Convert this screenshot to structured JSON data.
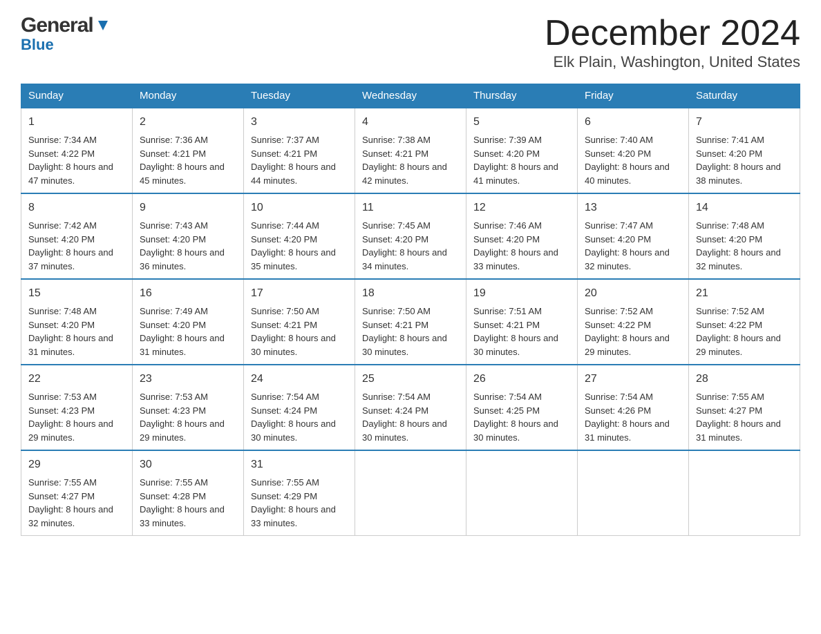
{
  "header": {
    "logo": {
      "general": "General",
      "blue": "Blue"
    },
    "month": "December 2024",
    "location": "Elk Plain, Washington, United States"
  },
  "days_of_week": [
    "Sunday",
    "Monday",
    "Tuesday",
    "Wednesday",
    "Thursday",
    "Friday",
    "Saturday"
  ],
  "weeks": [
    [
      {
        "day": "1",
        "sunrise": "7:34 AM",
        "sunset": "4:22 PM",
        "daylight": "8 hours and 47 minutes."
      },
      {
        "day": "2",
        "sunrise": "7:36 AM",
        "sunset": "4:21 PM",
        "daylight": "8 hours and 45 minutes."
      },
      {
        "day": "3",
        "sunrise": "7:37 AM",
        "sunset": "4:21 PM",
        "daylight": "8 hours and 44 minutes."
      },
      {
        "day": "4",
        "sunrise": "7:38 AM",
        "sunset": "4:21 PM",
        "daylight": "8 hours and 42 minutes."
      },
      {
        "day": "5",
        "sunrise": "7:39 AM",
        "sunset": "4:20 PM",
        "daylight": "8 hours and 41 minutes."
      },
      {
        "day": "6",
        "sunrise": "7:40 AM",
        "sunset": "4:20 PM",
        "daylight": "8 hours and 40 minutes."
      },
      {
        "day": "7",
        "sunrise": "7:41 AM",
        "sunset": "4:20 PM",
        "daylight": "8 hours and 38 minutes."
      }
    ],
    [
      {
        "day": "8",
        "sunrise": "7:42 AM",
        "sunset": "4:20 PM",
        "daylight": "8 hours and 37 minutes."
      },
      {
        "day": "9",
        "sunrise": "7:43 AM",
        "sunset": "4:20 PM",
        "daylight": "8 hours and 36 minutes."
      },
      {
        "day": "10",
        "sunrise": "7:44 AM",
        "sunset": "4:20 PM",
        "daylight": "8 hours and 35 minutes."
      },
      {
        "day": "11",
        "sunrise": "7:45 AM",
        "sunset": "4:20 PM",
        "daylight": "8 hours and 34 minutes."
      },
      {
        "day": "12",
        "sunrise": "7:46 AM",
        "sunset": "4:20 PM",
        "daylight": "8 hours and 33 minutes."
      },
      {
        "day": "13",
        "sunrise": "7:47 AM",
        "sunset": "4:20 PM",
        "daylight": "8 hours and 32 minutes."
      },
      {
        "day": "14",
        "sunrise": "7:48 AM",
        "sunset": "4:20 PM",
        "daylight": "8 hours and 32 minutes."
      }
    ],
    [
      {
        "day": "15",
        "sunrise": "7:48 AM",
        "sunset": "4:20 PM",
        "daylight": "8 hours and 31 minutes."
      },
      {
        "day": "16",
        "sunrise": "7:49 AM",
        "sunset": "4:20 PM",
        "daylight": "8 hours and 31 minutes."
      },
      {
        "day": "17",
        "sunrise": "7:50 AM",
        "sunset": "4:21 PM",
        "daylight": "8 hours and 30 minutes."
      },
      {
        "day": "18",
        "sunrise": "7:50 AM",
        "sunset": "4:21 PM",
        "daylight": "8 hours and 30 minutes."
      },
      {
        "day": "19",
        "sunrise": "7:51 AM",
        "sunset": "4:21 PM",
        "daylight": "8 hours and 30 minutes."
      },
      {
        "day": "20",
        "sunrise": "7:52 AM",
        "sunset": "4:22 PM",
        "daylight": "8 hours and 29 minutes."
      },
      {
        "day": "21",
        "sunrise": "7:52 AM",
        "sunset": "4:22 PM",
        "daylight": "8 hours and 29 minutes."
      }
    ],
    [
      {
        "day": "22",
        "sunrise": "7:53 AM",
        "sunset": "4:23 PM",
        "daylight": "8 hours and 29 minutes."
      },
      {
        "day": "23",
        "sunrise": "7:53 AM",
        "sunset": "4:23 PM",
        "daylight": "8 hours and 29 minutes."
      },
      {
        "day": "24",
        "sunrise": "7:54 AM",
        "sunset": "4:24 PM",
        "daylight": "8 hours and 30 minutes."
      },
      {
        "day": "25",
        "sunrise": "7:54 AM",
        "sunset": "4:24 PM",
        "daylight": "8 hours and 30 minutes."
      },
      {
        "day": "26",
        "sunrise": "7:54 AM",
        "sunset": "4:25 PM",
        "daylight": "8 hours and 30 minutes."
      },
      {
        "day": "27",
        "sunrise": "7:54 AM",
        "sunset": "4:26 PM",
        "daylight": "8 hours and 31 minutes."
      },
      {
        "day": "28",
        "sunrise": "7:55 AM",
        "sunset": "4:27 PM",
        "daylight": "8 hours and 31 minutes."
      }
    ],
    [
      {
        "day": "29",
        "sunrise": "7:55 AM",
        "sunset": "4:27 PM",
        "daylight": "8 hours and 32 minutes."
      },
      {
        "day": "30",
        "sunrise": "7:55 AM",
        "sunset": "4:28 PM",
        "daylight": "8 hours and 33 minutes."
      },
      {
        "day": "31",
        "sunrise": "7:55 AM",
        "sunset": "4:29 PM",
        "daylight": "8 hours and 33 minutes."
      },
      null,
      null,
      null,
      null
    ]
  ],
  "labels": {
    "sunrise": "Sunrise:",
    "sunset": "Sunset:",
    "daylight": "Daylight:"
  }
}
